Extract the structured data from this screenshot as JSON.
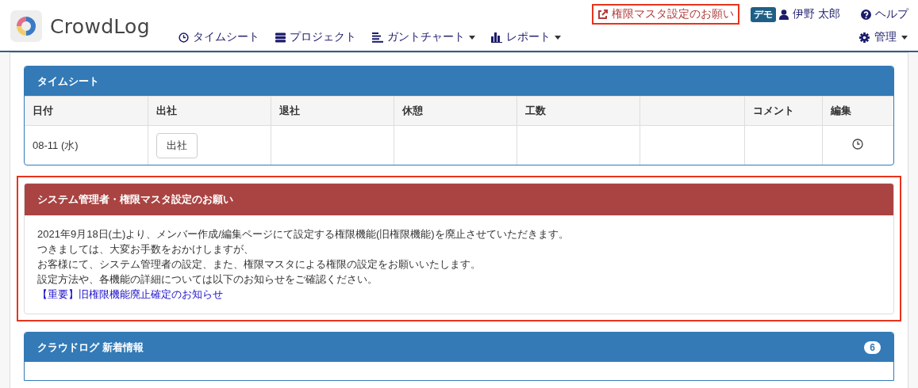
{
  "header": {
    "logo": "CrowdLog",
    "nav": [
      {
        "label": "タイムシート",
        "kind": "clock",
        "dropdown": false
      },
      {
        "label": "プロジェクト",
        "kind": "server",
        "dropdown": false
      },
      {
        "label": "ガントチャート",
        "kind": "gantt",
        "dropdown": true
      },
      {
        "label": "レポート",
        "kind": "bars",
        "dropdown": true
      }
    ],
    "notice_link": {
      "label": "権限マスタ設定のお願い",
      "highlighted": true
    },
    "demo_badge": "デモ",
    "user": "伊野 太郎",
    "help": "ヘルプ",
    "admin": {
      "label": "管理",
      "dropdown": true
    }
  },
  "timesheet": {
    "title": "タイムシート",
    "columns": [
      "日付",
      "出社",
      "退社",
      "休憩",
      "工数",
      "",
      "コメント",
      "編集"
    ],
    "rows": [
      {
        "date": "08-11 (水)",
        "checkin_button": "出社"
      }
    ]
  },
  "notice": {
    "title": "システム管理者・権限マスタ設定のお願い",
    "highlighted": true,
    "lines": [
      "2021年9月18日(土)より、メンバー作成/編集ページにて設定する権限機能(旧権限機能)を廃止させていただきます。",
      "つきましては、大変お手数をおかけしますが、",
      "お客様にて、システム管理者の設定、また、権限マスタによる権限の設定をお願いいたします。",
      "設定方法や、各機能の詳細については以下のお知らせをご確認ください。"
    ],
    "link": "【重要】旧権限機能廃止確定のお知らせ"
  },
  "news": {
    "title": "クラウドログ 新着情報",
    "count": "6"
  }
}
